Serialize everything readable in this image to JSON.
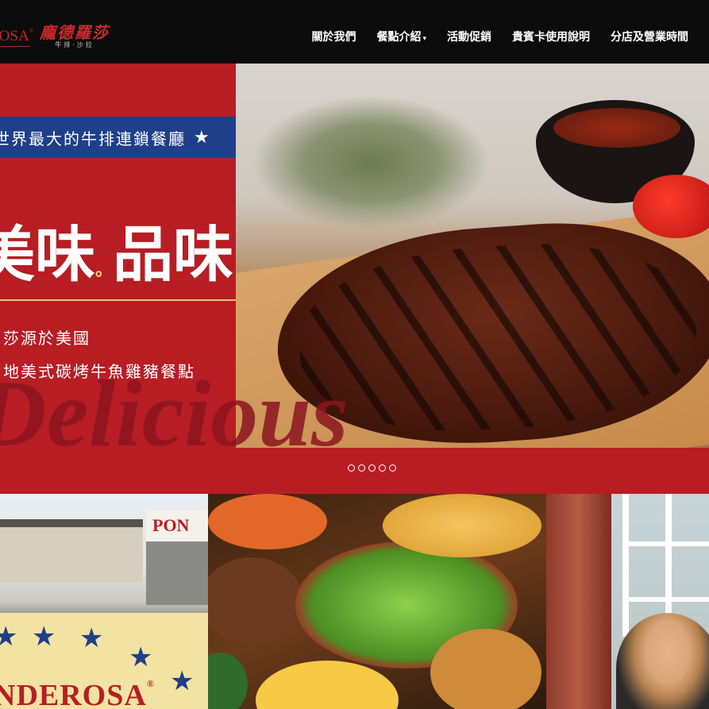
{
  "header": {
    "logo_en": "ROSA",
    "logo_reg": "®",
    "logo_zh": "龐德羅莎",
    "logo_zh_sub": "牛排·沙拉",
    "nav": [
      {
        "label": "關於我們",
        "dropdown": false
      },
      {
        "label": "餐點介紹",
        "dropdown": true
      },
      {
        "label": "活動促銷",
        "dropdown": false
      },
      {
        "label": "貴賓卡使用說明",
        "dropdown": false
      },
      {
        "label": "分店及營業時間",
        "dropdown": false
      }
    ]
  },
  "hero": {
    "banner": "世界最大的牛排連鎖餐廳",
    "headline_a": "美味",
    "headline_dot": "。",
    "headline_b": "品味",
    "sub1": "莎源於美國",
    "sub2": "地美式碳烤牛魚雞豬餐點",
    "script": "Delicious",
    "slide_count": 5,
    "active_slide": 0
  },
  "tiles": {
    "tile1": {
      "sign": "PONDEROSA",
      "sign_short": "PON",
      "panel_word": "NDEROSA",
      "panel_reg": "®"
    },
    "tile2": {
      "alt": "salad and food spread"
    },
    "tile3": {
      "alt": "woman at window"
    }
  },
  "colors": {
    "brand_red": "#b81d24",
    "nav_bg": "#0c0c0c",
    "banner_blue": "#1f3f8a",
    "gold": "#e6c56b"
  }
}
